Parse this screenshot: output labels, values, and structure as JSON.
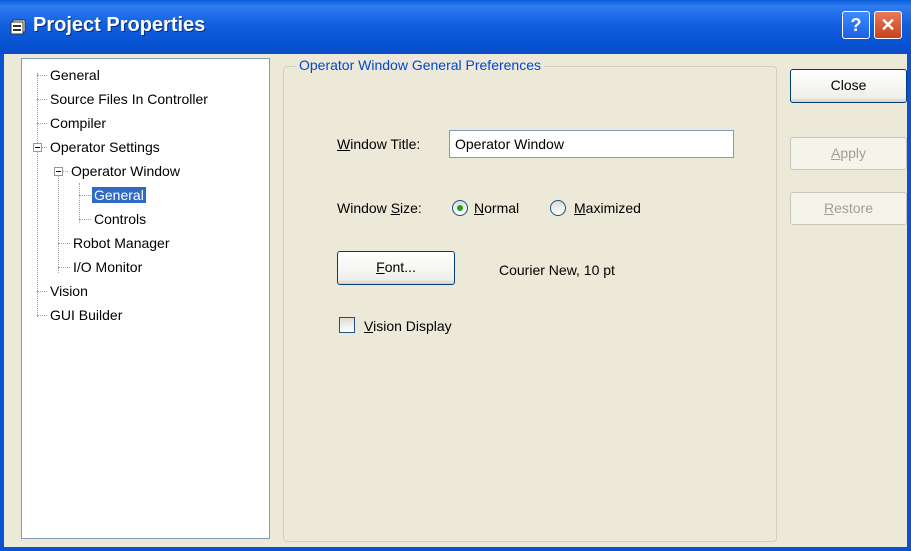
{
  "window": {
    "title": "Project Properties"
  },
  "titlebar": {
    "help_glyph": "?",
    "close_glyph": "✕"
  },
  "tree": {
    "items": [
      {
        "label": "General"
      },
      {
        "label": "Source Files In Controller"
      },
      {
        "label": "Compiler"
      },
      {
        "label": "Operator Settings"
      },
      {
        "label": "Operator Window"
      },
      {
        "label": "General"
      },
      {
        "label": "Controls"
      },
      {
        "label": "Robot Manager"
      },
      {
        "label": "I/O Monitor"
      },
      {
        "label": "Vision"
      },
      {
        "label": "GUI Builder"
      }
    ]
  },
  "group": {
    "legend": "Operator Window General Preferences"
  },
  "window_title": {
    "label_mnemonic": "W",
    "label_rest": "indow Title:",
    "value": "Operator Window"
  },
  "window_size": {
    "label_a": "Window ",
    "label_mnemonic": "S",
    "label_b": "ize:",
    "normal_mnemonic": "N",
    "normal_rest": "ormal",
    "maximized_mnemonic": "M",
    "maximized_rest": "aximized",
    "selected": "Normal"
  },
  "font": {
    "button_mnemonic": "F",
    "button_rest": "ont...",
    "value": "Courier New, 10 pt"
  },
  "vision_display": {
    "mnemonic": "V",
    "rest": "ision Display",
    "checked": false
  },
  "buttons": {
    "close": "Close",
    "apply_mnemonic": "A",
    "apply_rest": "pply",
    "restore_mnemonic": "R",
    "restore_rest": "estore"
  }
}
